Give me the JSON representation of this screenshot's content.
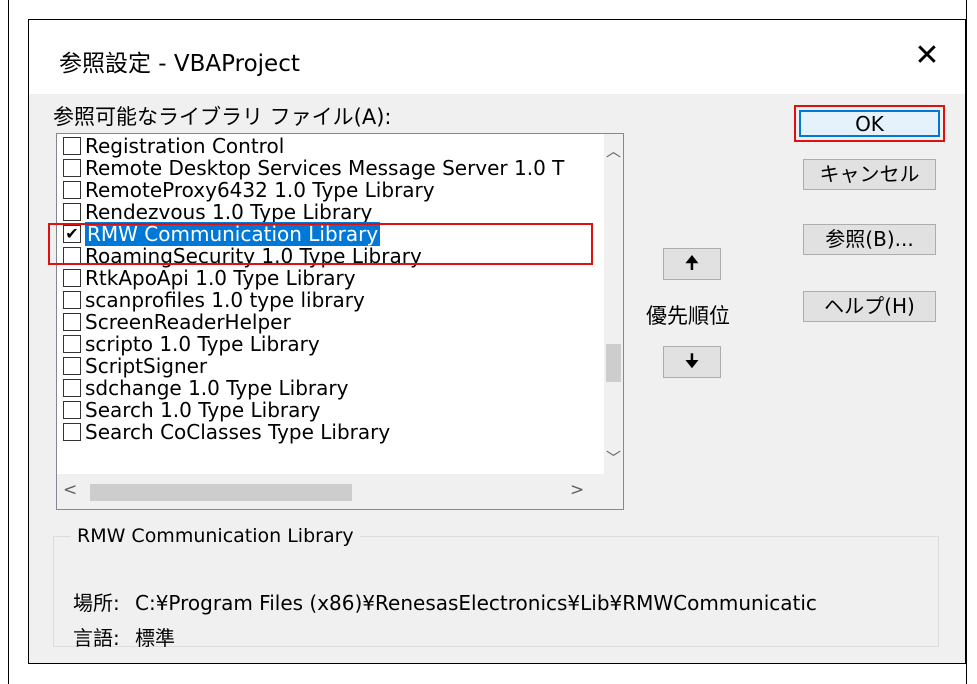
{
  "dialog": {
    "title": "参照設定 - VBAProject",
    "close_glyph": "✕"
  },
  "list": {
    "label": "参照可能なライブラリ ファイル(A):",
    "items": [
      {
        "label": "Registration Control",
        "checked": false,
        "selected": false
      },
      {
        "label": "Remote Desktop Services Message Server 1.0 T",
        "checked": false,
        "selected": false
      },
      {
        "label": "RemoteProxy6432 1.0 Type Library",
        "checked": false,
        "selected": false
      },
      {
        "label": "Rendezvous 1.0 Type Library",
        "checked": false,
        "selected": false
      },
      {
        "label": "RMW Communication Library",
        "checked": true,
        "selected": true
      },
      {
        "label": "RoamingSecurity 1.0 Type Library",
        "checked": false,
        "selected": false
      },
      {
        "label": "RtkApoApi 1.0 Type Library",
        "checked": false,
        "selected": false
      },
      {
        "label": "scanprofiles 1.0 type library",
        "checked": false,
        "selected": false
      },
      {
        "label": "ScreenReaderHelper",
        "checked": false,
        "selected": false
      },
      {
        "label": "scripto 1.0 Type Library",
        "checked": false,
        "selected": false
      },
      {
        "label": "ScriptSigner",
        "checked": false,
        "selected": false
      },
      {
        "label": "sdchange 1.0 Type Library",
        "checked": false,
        "selected": false
      },
      {
        "label": "Search 1.0 Type Library",
        "checked": false,
        "selected": false
      },
      {
        "label": "Search CoClasses Type Library",
        "checked": false,
        "selected": false
      }
    ],
    "check_glyph": "✔",
    "scroll_up_glyph": "︿",
    "scroll_down_glyph": "﹀",
    "scroll_left_glyph": "<",
    "scroll_right_glyph": ">"
  },
  "buttons": {
    "ok": "OK",
    "cancel": "キャンセル",
    "browse": "参照(B)...",
    "help": "ヘルプ(H)",
    "priority_up": "🠉",
    "priority_down": "🠋"
  },
  "priority_label": "優先順位",
  "details": {
    "group_title": "RMW Communication Library",
    "location_label": "場所:",
    "location_value": "C:¥Program Files (x86)¥RenesasElectronics¥Lib¥RMWCommunicatic",
    "language_label": "言語:",
    "language_value": "標準"
  },
  "colors": {
    "selection": "#0078d7",
    "highlight_box": "#e01010",
    "dialog_bg": "#f0f0f0"
  }
}
